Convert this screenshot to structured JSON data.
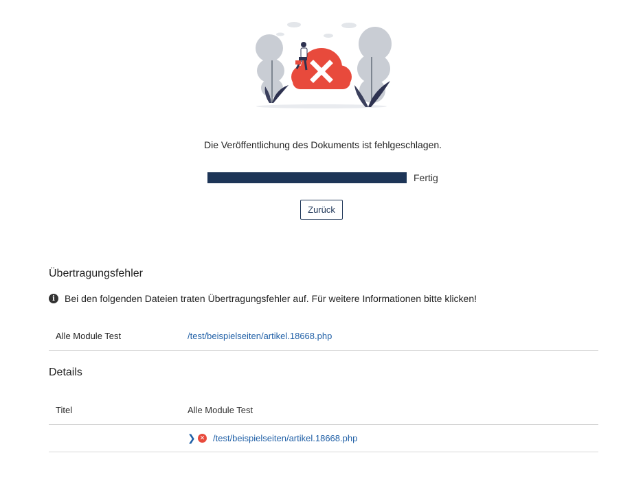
{
  "status": {
    "message": "Die Veröffentlichung des Dokuments ist fehlgeschlagen.",
    "progress_percent": 100,
    "progress_label": "Fertig",
    "back_button": "Zurück"
  },
  "transfer_errors": {
    "title": "Übertragungsfehler",
    "info_text": "Bei den folgenden Dateien traten Übertragungsfehler auf. Für weitere Informationen bitte klicken!",
    "rows": [
      {
        "name": "Alle Module Test",
        "path": "/test/beispielseiten/artikel.18668.php"
      }
    ]
  },
  "details": {
    "title": "Details",
    "title_label": "Titel",
    "title_value": "Alle Module Test",
    "file_path": "/test/beispielseiten/artikel.18668.php"
  },
  "colors": {
    "primary": "#1d3557",
    "link": "#1f5fa6",
    "error": "#e84a3c"
  },
  "icons": [
    "error-cloud-illustration",
    "info-icon",
    "chevron-right-icon",
    "error-circle-icon"
  ]
}
